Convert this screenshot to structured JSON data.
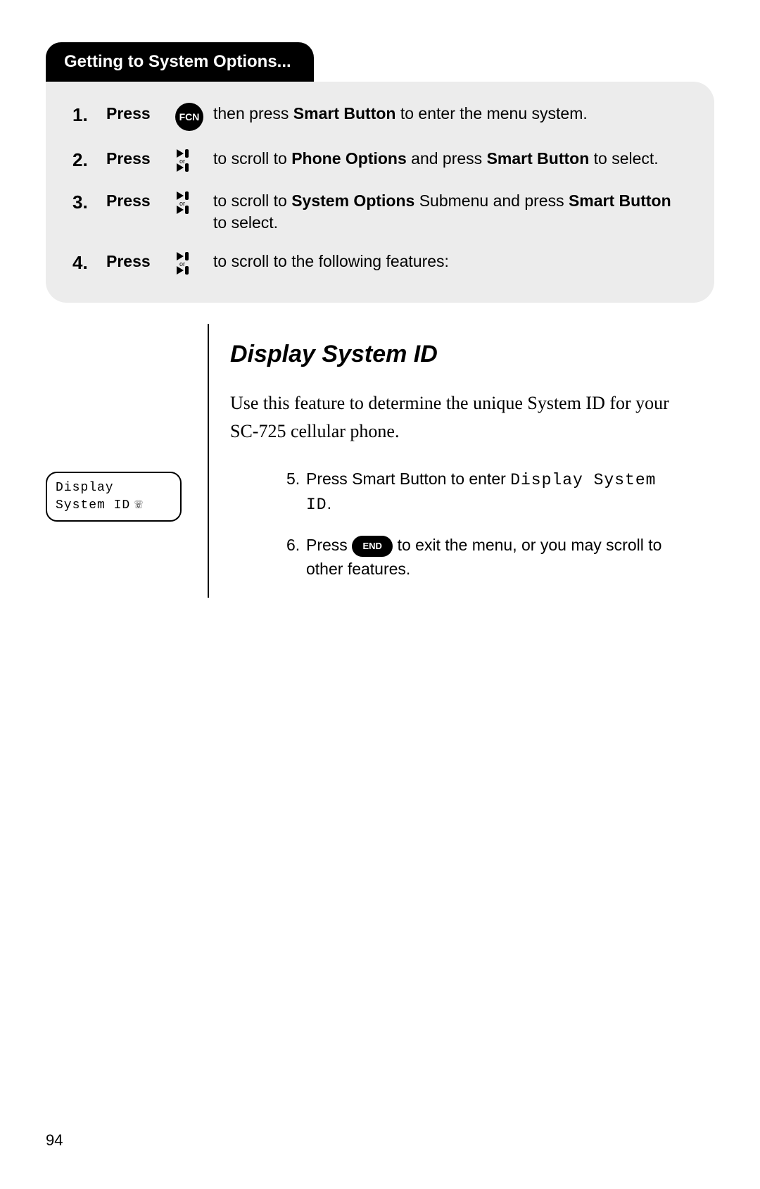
{
  "tab_title": "Getting to System Options...",
  "steps": {
    "s1": {
      "num": "1.",
      "press": "Press",
      "fcn": "FCN",
      "t1": " then press ",
      "b1": "Smart Button",
      "t2": " to enter the menu system."
    },
    "s2": {
      "num": "2.",
      "press": "Press",
      "t1": " to scroll to ",
      "b1": "Phone Options",
      "t2": " and press ",
      "b2": "Smart Button",
      "t3": " to select."
    },
    "s3": {
      "num": "3.",
      "press": "Press",
      "t1": " to scroll to ",
      "b1": "System Options",
      "t2": " Submenu and press ",
      "b2": "Smart Button",
      "t3": " to select."
    },
    "s4": {
      "num": "4.",
      "press": "Press",
      "t1": " to scroll to the following features:"
    }
  },
  "heading": "Display System ID",
  "lead": "Use this feature to determine the unique System ID for your SC-725 cellular phone.",
  "lcd": {
    "line1": "Display",
    "line2": "System ID",
    "iconglyph": "☏"
  },
  "steps2": {
    "s5": {
      "num": "5.",
      "t1": "Press Smart Button to enter ",
      "mono": "Display System ID",
      "t2": "."
    },
    "s6": {
      "num": "6.",
      "t1": "Press ",
      "end": "END",
      "t2": " to exit the menu, or you may scroll to other features."
    }
  },
  "page_number": "94"
}
